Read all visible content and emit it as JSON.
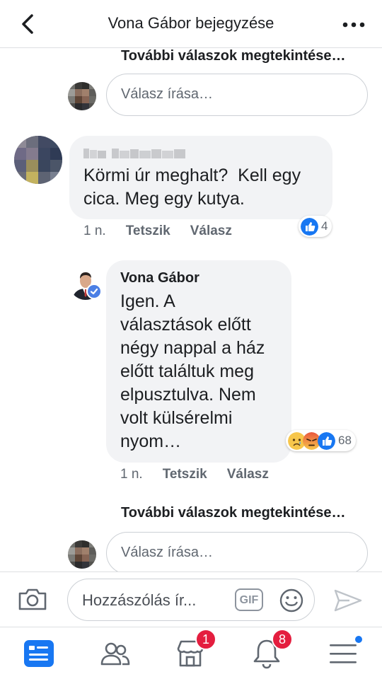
{
  "header": {
    "title": "Vona Gábor bejegyzése",
    "back_icon": "chevron-left-icon",
    "more_icon": "ellipsis-icon"
  },
  "thread": {
    "more_replies_top": "További válaszok megtekintése…",
    "reply_placeholder_top": "Válasz írása…",
    "comment1": {
      "text": "Körmi úr meghalt?  Kell egy\ncica. Meg egy kutya.",
      "time": "1 n.",
      "like_label": "Tetszik",
      "reply_label": "Válasz",
      "reaction_count": "4",
      "reactions": [
        "like"
      ]
    },
    "comment2": {
      "author": "Vona Gábor",
      "text": "Igen. A\nválasztások előtt\nnégy nappal a ház\nelőtt találtuk meg\nelpusztulva. Nem\nvolt külsérelmi\nnyom…",
      "time": "1 n.",
      "like_label": "Tetszik",
      "reply_label": "Válasz",
      "reaction_count": "68",
      "reactions": [
        "sad",
        "angry",
        "like"
      ]
    },
    "more_replies_bottom": "További válaszok megtekintése…",
    "reply_placeholder_bottom": "Válasz írása…"
  },
  "composer": {
    "placeholder": "Hozzászólás ír...",
    "gif_label": "GIF",
    "camera_icon": "camera-icon",
    "emoji_icon": "smiley-icon",
    "send_icon": "send-icon"
  },
  "tabbar": {
    "tabs": [
      {
        "name": "news-feed",
        "icon": "news-feed-icon",
        "active": true
      },
      {
        "name": "friends",
        "icon": "friends-icon"
      },
      {
        "name": "marketplace",
        "icon": "marketplace-icon",
        "badge": "1"
      },
      {
        "name": "notifications",
        "icon": "bell-icon",
        "badge": "8"
      },
      {
        "name": "menu",
        "icon": "menu-icon",
        "dot": true
      }
    ]
  },
  "colors": {
    "accent": "#1877f2",
    "badge": "#e41e3f",
    "bubble": "#f2f3f5",
    "meta_text": "#606770"
  }
}
